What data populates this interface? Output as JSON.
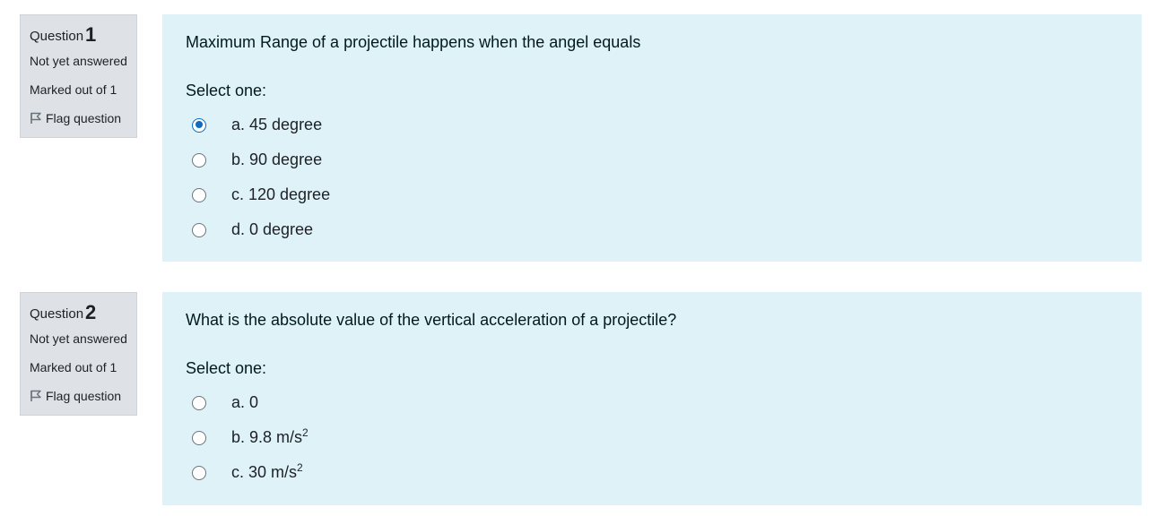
{
  "questions": [
    {
      "label": "Question",
      "number": "1",
      "state": "Not yet answered",
      "grade": "Marked out of 1",
      "flag": "Flag question",
      "text": "Maximum Range of a projectile happens when the angel equals",
      "prompt": "Select one:",
      "answers": [
        {
          "text": "a. 45 degree",
          "sup": "",
          "checked": true
        },
        {
          "text": "b. 90 degree",
          "sup": "",
          "checked": false
        },
        {
          "text": "c. 120 degree",
          "sup": "",
          "checked": false
        },
        {
          "text": "d. 0 degree",
          "sup": "",
          "checked": false
        }
      ]
    },
    {
      "label": "Question",
      "number": "2",
      "state": "Not yet answered",
      "grade": "Marked out of 1",
      "flag": "Flag question",
      "text": "What is the absolute value of the vertical acceleration of a projectile?",
      "prompt": "Select one:",
      "answers": [
        {
          "text": "a. 0",
          "sup": "",
          "checked": false
        },
        {
          "text": "b. 9.8 m/s",
          "sup": "2",
          "checked": false
        },
        {
          "text": "c. 30 m/s",
          "sup": "2",
          "checked": false
        }
      ]
    }
  ],
  "colors": {
    "info_bg": "#dee2e6",
    "content_bg": "#def2f8",
    "radio_selected": "#0f6cbf"
  },
  "icons": {
    "flag": "flag-outline-icon"
  }
}
